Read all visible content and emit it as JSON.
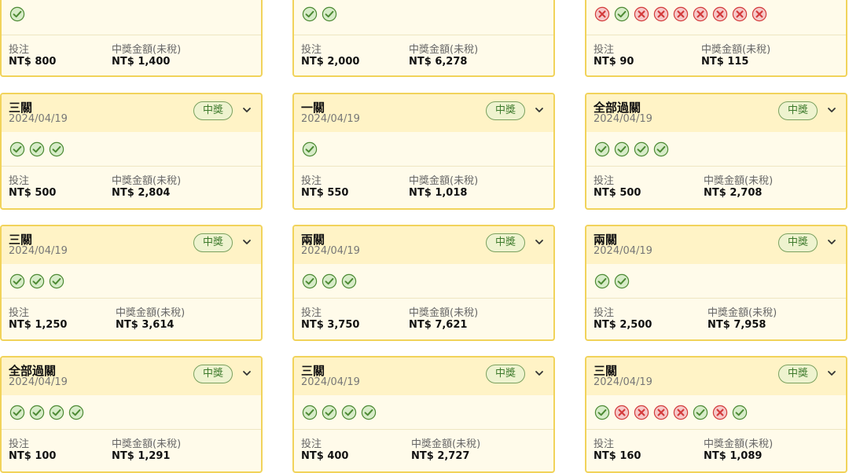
{
  "labels": {
    "stake": "投注",
    "payout": "中獎金額(未稅)"
  },
  "colors": {
    "card_border": "#f1d35b",
    "header_bg": "#fff3c6",
    "win": "#4d8a34",
    "lose": "#d33b3b"
  },
  "cards": [
    {
      "type": "",
      "date": "",
      "badge": "",
      "results": [
        "win"
      ],
      "stake": "NT$ 800",
      "payout": "NT$ 1,400"
    },
    {
      "type": "",
      "date": "",
      "badge": "",
      "results": [
        "win",
        "win"
      ],
      "stake": "NT$ 2,000",
      "payout": "NT$ 6,278"
    },
    {
      "type": "",
      "date": "",
      "badge": "",
      "results": [
        "lose",
        "win",
        "lose",
        "lose",
        "lose",
        "lose",
        "lose",
        "lose",
        "lose"
      ],
      "stake": "NT$ 90",
      "payout": "NT$ 115"
    },
    {
      "type": "三關",
      "date": "2024/04/19",
      "badge": "中獎",
      "results": [
        "win",
        "win",
        "win"
      ],
      "stake": "NT$ 500",
      "payout": "NT$ 2,804"
    },
    {
      "type": "一關",
      "date": "2024/04/19",
      "badge": "中獎",
      "results": [
        "win"
      ],
      "stake": "NT$ 550",
      "payout": "NT$ 1,018"
    },
    {
      "type": "全部過關",
      "date": "2024/04/19",
      "badge": "中獎",
      "results": [
        "win",
        "win",
        "win",
        "win"
      ],
      "stake": "NT$ 500",
      "payout": "NT$ 2,708"
    },
    {
      "type": "三關",
      "date": "2024/04/19",
      "badge": "中獎",
      "results": [
        "win",
        "win",
        "win"
      ],
      "stake": "NT$ 1,250",
      "payout": "NT$ 3,614"
    },
    {
      "type": "兩關",
      "date": "2024/04/19",
      "badge": "中獎",
      "results": [
        "win",
        "win",
        "win"
      ],
      "stake": "NT$ 3,750",
      "payout": "NT$ 7,621"
    },
    {
      "type": "兩關",
      "date": "2024/04/19",
      "badge": "中獎",
      "results": [
        "win",
        "win"
      ],
      "stake": "NT$ 2,500",
      "payout": "NT$ 7,958"
    },
    {
      "type": "全部過關",
      "date": "2024/04/19",
      "badge": "中獎",
      "results": [
        "win",
        "win",
        "win",
        "win"
      ],
      "stake": "NT$ 100",
      "payout": "NT$ 1,291"
    },
    {
      "type": "三關",
      "date": "2024/04/19",
      "badge": "中獎",
      "results": [
        "win",
        "win",
        "win",
        "win"
      ],
      "stake": "NT$ 400",
      "payout": "NT$ 2,727"
    },
    {
      "type": "三關",
      "date": "2024/04/19",
      "badge": "中獎",
      "results": [
        "win",
        "lose",
        "lose",
        "lose",
        "lose",
        "win",
        "lose",
        "win"
      ],
      "stake": "NT$ 160",
      "payout": "NT$ 1,089"
    }
  ]
}
